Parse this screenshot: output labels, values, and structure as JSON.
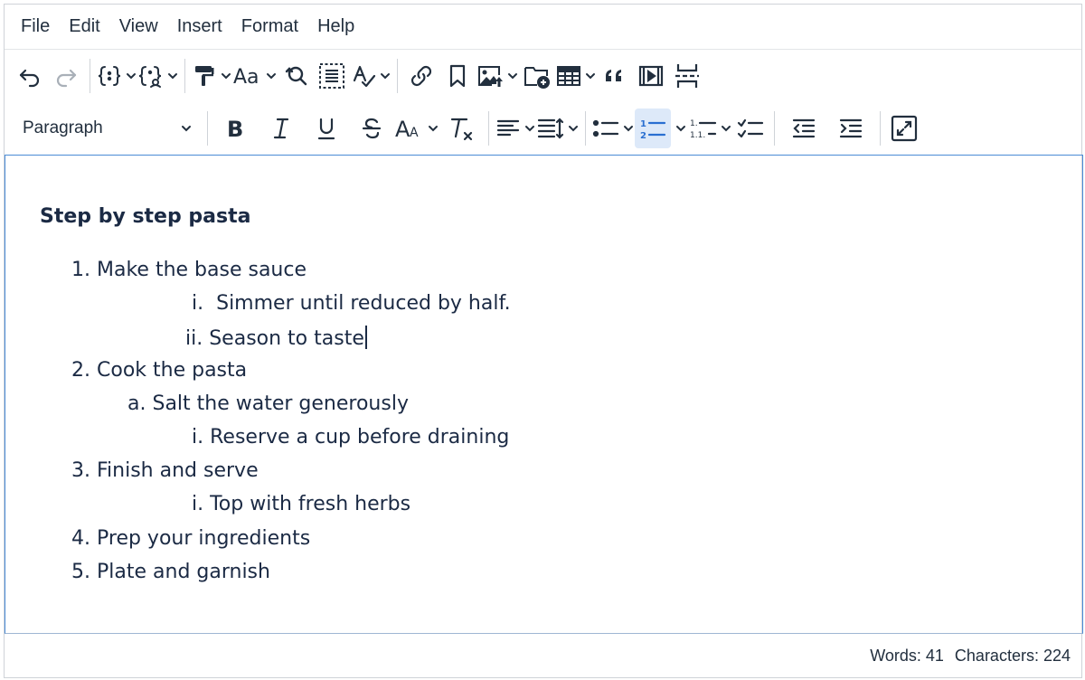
{
  "menubar": {
    "items": [
      "File",
      "Edit",
      "View",
      "Insert",
      "Format",
      "Help"
    ]
  },
  "toolbar": {
    "row1_icons": [
      "undo-icon",
      "redo-icon",
      "code-brackets-icon",
      "merge-tags-icon",
      "format-painter-icon",
      "font-size-icon",
      "find-replace-icon",
      "select-all-icon",
      "spellcheck-icon",
      "link-icon",
      "bookmark-icon",
      "image-icon",
      "file-manager-icon",
      "table-icon",
      "blockquote-icon",
      "media-icon",
      "page-break-icon"
    ],
    "block_format": "Paragraph",
    "row2_icons": [
      "bold-icon",
      "italic-icon",
      "underline-icon",
      "strikethrough-icon",
      "font-case-icon",
      "clear-formatting-icon",
      "align-left-icon",
      "line-height-icon",
      "bullet-list-icon",
      "numbered-list-icon",
      "multilevel-list-icon",
      "checklist-icon",
      "outdent-icon",
      "indent-icon",
      "fullscreen-icon"
    ],
    "active_icon": "numbered-list-icon",
    "active_color": "#dde9f9",
    "accent_color": "#2a6fd1"
  },
  "document": {
    "title": "Step by step pasta",
    "lines": [
      {
        "marker": "1.",
        "text": "Make the base sauce"
      },
      {
        "marker": "i.",
        "text": "Simmer until reduced by half."
      },
      {
        "marker": "ii.",
        "text": "Season to taste"
      },
      {
        "marker": "2.",
        "text": "Cook the pasta"
      },
      {
        "marker": "a.",
        "text": "Salt the water generously"
      },
      {
        "marker": "i.",
        "text": "Reserve a cup before draining"
      },
      {
        "marker": "3.",
        "text": "Finish and serve"
      },
      {
        "marker": "i.",
        "text": "Top with fresh herbs"
      },
      {
        "marker": "4.",
        "text": "Prep your ingredients"
      },
      {
        "marker": "5.",
        "text": "Plate and garnish"
      }
    ]
  },
  "statusbar": {
    "words": "Words: 41",
    "characters": "Characters: 224"
  }
}
